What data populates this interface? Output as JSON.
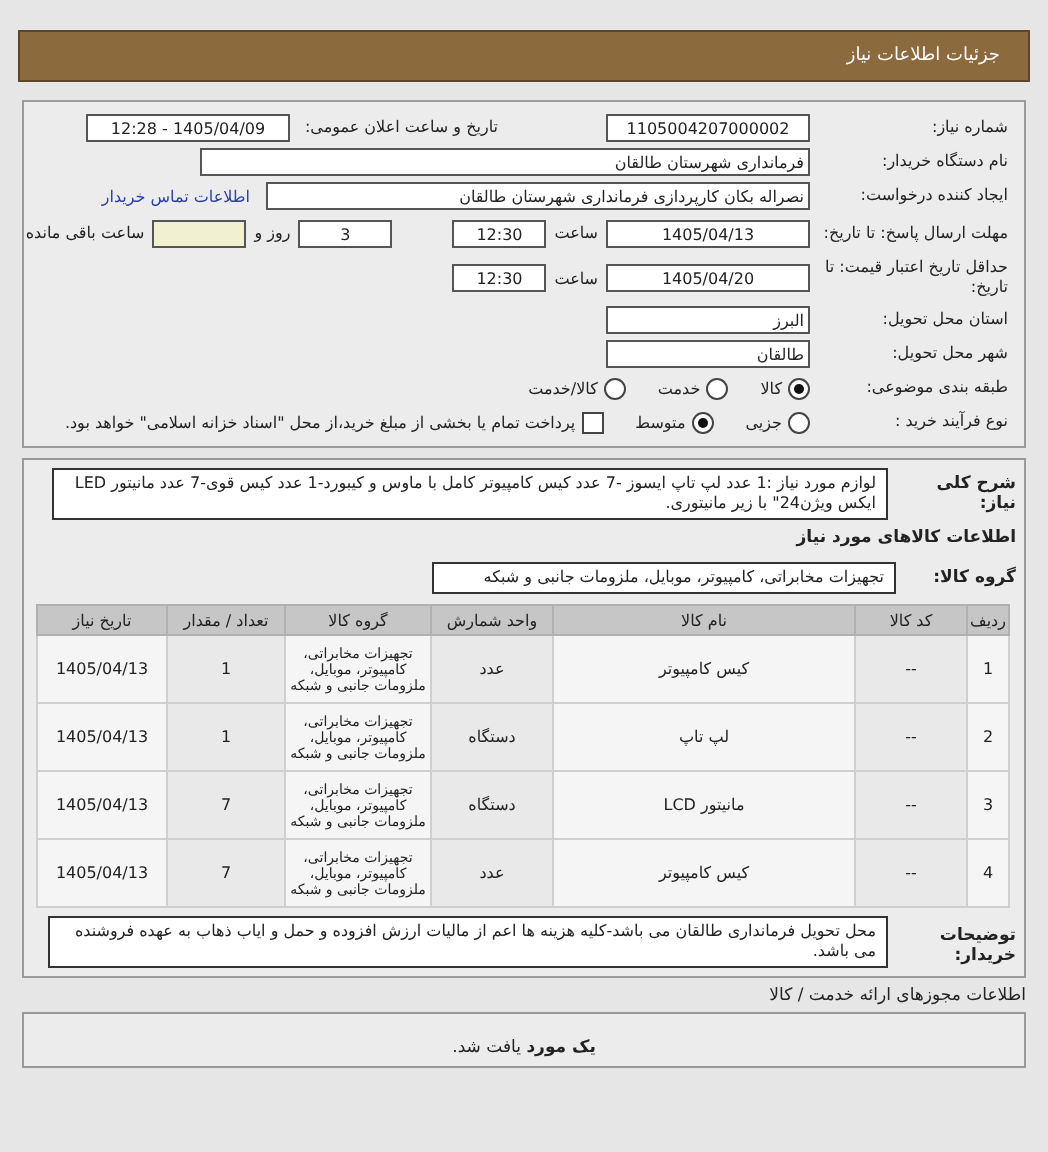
{
  "header": {
    "title": "جزئیات اطلاعات نیاز"
  },
  "need_number": {
    "label": "شماره نیاز:",
    "value": "1105004207000002"
  },
  "announce": {
    "label": "تاریخ و ساعت اعلان عمومی:",
    "value": "1405/04/09 - 12:28"
  },
  "buyer_org": {
    "label": "نام دستگاه خریدار:",
    "value": "فرمانداری شهرستان طالقان"
  },
  "requester": {
    "label": "ایجاد کننده درخواست:",
    "value": "نصراله بکان کارپردازی فرمانداری شهرستان طالقان",
    "link": "اطلاعات تماس خریدار"
  },
  "deadline": {
    "label": "مهلت ارسال پاسخ: تا تاریخ:",
    "date": "1405/04/13",
    "time_label": "ساعت",
    "time": "12:30",
    "days": "3",
    "days_label": "روز و",
    "remaining_label": "ساعت باقی مانده"
  },
  "validity": {
    "label": "حداقل تاریخ اعتبار قیمت: تا تاریخ:",
    "date": "1405/04/20",
    "time_label": "ساعت",
    "time": "12:30"
  },
  "province": {
    "label": "استان محل تحویل:",
    "value": "البرز"
  },
  "city": {
    "label": "شهر محل تحویل:",
    "value": "طالقان"
  },
  "category": {
    "label": "طبقه بندی موضوعی:",
    "options": [
      {
        "label": "کالا",
        "selected": true
      },
      {
        "label": "خدمت",
        "selected": false
      },
      {
        "label": "کالا/خدمت",
        "selected": false
      }
    ]
  },
  "process": {
    "label": "نوع فرآیند خرید :",
    "options": [
      {
        "label": "جزیی",
        "selected": false
      },
      {
        "label": "متوسط",
        "selected": true
      }
    ],
    "payment": {
      "checked": false,
      "label": "پرداخت تمام یا بخشی از مبلغ خرید،از محل \"اسناد خزانه اسلامی\" خواهد بود."
    }
  },
  "description": {
    "label": "شرح کلی نیاز:",
    "text": "لوازم مورد نیاز :1 عدد لپ تاپ ایسوز -7 عدد کیس کامپیوتر کامل با ماوس و کیبورد-1 عدد کیس قوی-7 عدد مانیتور LED ایکس ویژن24\" با زیر مانیتوری."
  },
  "goods_title": "اطلاعات کالاهای مورد نیاز",
  "goods_group": {
    "label": "گروه کالا:",
    "value": "تجهیزات مخابراتی، کامپیوتر، موبایل، ملزومات جانبی و شبکه"
  },
  "table": {
    "columns": [
      "ردیف",
      "کد کالا",
      "نام کالا",
      "واحد شمارش",
      "گروه کالا",
      "تعداد / مقدار",
      "تاریخ نیاز"
    ],
    "rows": [
      [
        "1",
        "--",
        "کیس کامپیوتر",
        "عدد",
        "تجهیزات مخابراتی، کامپیوتر، موبایل، ملزومات جانبی و شبکه",
        "1",
        "1405/04/13"
      ],
      [
        "2",
        "--",
        "لپ تاپ",
        "دستگاه",
        "تجهیزات مخابراتی، کامپیوتر، موبایل، ملزومات جانبی و شبکه",
        "1",
        "1405/04/13"
      ],
      [
        "3",
        "--",
        "مانیتور LCD",
        "دستگاه",
        "تجهیزات مخابراتی، کامپیوتر، موبایل، ملزومات جانبی و شبکه",
        "7",
        "1405/04/13"
      ],
      [
        "4",
        "--",
        "کیس کامپیوتر",
        "عدد",
        "تجهیزات مخابراتی، کامپیوتر، موبایل، ملزومات جانبی و شبکه",
        "7",
        "1405/04/13"
      ]
    ]
  },
  "buyer_notes": {
    "label": "توضیحات خریدار:",
    "text": "محل تحویل فرمانداری طالقان می باشد-کلیه هزینه ها اعم از مالیات ارزش افزوده و حمل و ایاب ذهاب به عهده فروشنده می باشد."
  },
  "licenses": {
    "title": "اطلاعات مجوزهای ارائه خدمت / کالا",
    "result": "**یک مورد** یافت شد."
  }
}
